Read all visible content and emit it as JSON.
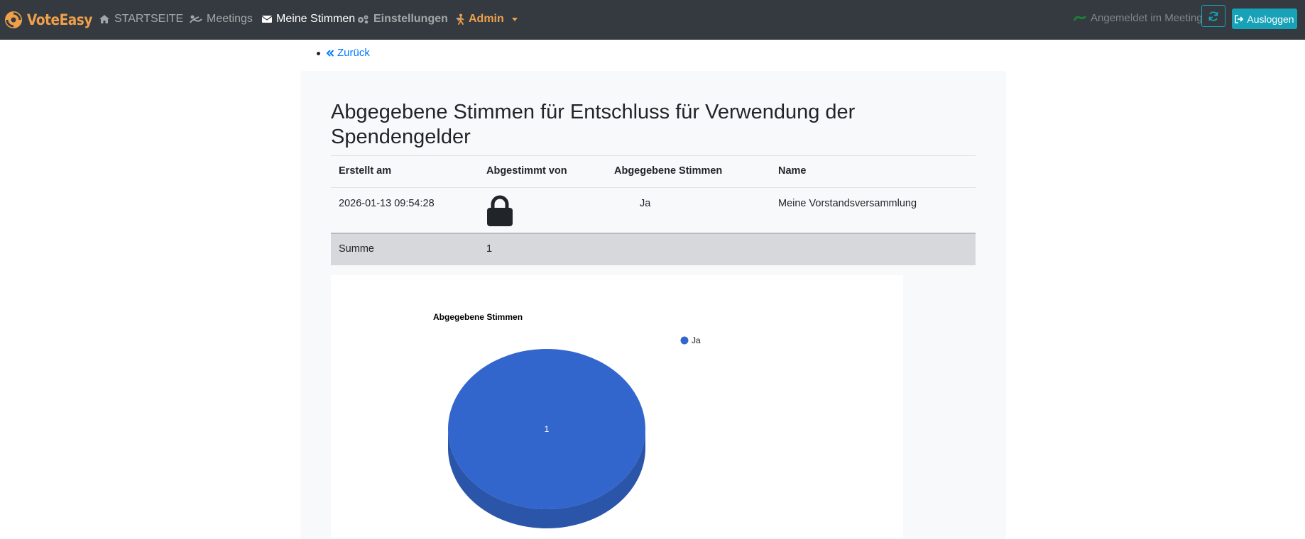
{
  "navbar": {
    "brand": "VoteEasy",
    "items": [
      {
        "label": "STARTSEITE",
        "icon": "home-icon"
      },
      {
        "label": "Meetings",
        "icon": "meeting-icon"
      },
      {
        "label": "Meine Stimmen",
        "icon": "envelope-icon"
      },
      {
        "label": "Einstellungen",
        "icon": "cogs-icon"
      },
      {
        "label": "Admin",
        "icon": "person-icon"
      }
    ],
    "status": "Angemeldet im Meeting",
    "logout": "Ausloggen"
  },
  "back_label": "Zurück",
  "title": "Abgegebene Stimmen für Entschluss für Verwendung der Spendengelder",
  "table": {
    "headers": [
      "Erstellt am",
      "Abgestimmt von",
      "Abgegebene Stimmen",
      "Name"
    ],
    "rows": [
      {
        "created": "2026-01-13 09:54:28",
        "voter": "lock-icon",
        "vote": "Ja",
        "name": "Meine Vorstandsversammlung"
      }
    ],
    "footer": {
      "label": "Summe",
      "value": "1"
    }
  },
  "colors": {
    "brand": "#f0a04b",
    "info": "#17a2b8",
    "link": "#007bff",
    "pie": "#3366cc"
  },
  "chart_data": {
    "type": "pie",
    "title": "Abgegebene Stimmen",
    "categories": [
      "Ja"
    ],
    "values": [
      1
    ],
    "data_labels": [
      "1"
    ],
    "legend": "right",
    "three_d": true
  }
}
